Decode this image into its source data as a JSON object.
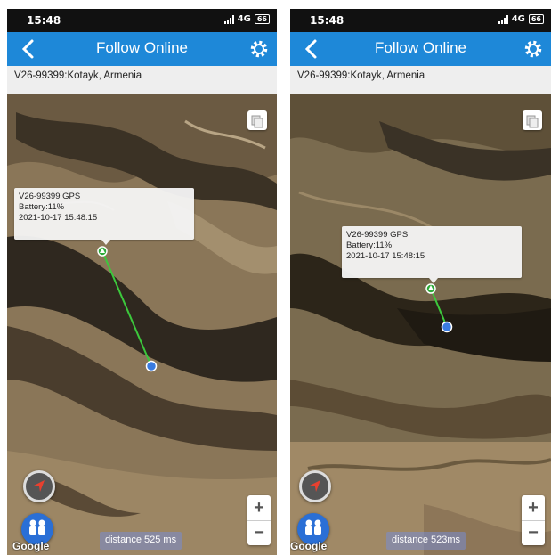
{
  "screens": [
    {
      "status": {
        "time": "15:48",
        "network": "4G",
        "battery": "66"
      },
      "header": {
        "title": "Follow Online"
      },
      "location_label": "V26-99399:Kotayk, Armenia",
      "marker_info": {
        "device": "V26-99399 GPS",
        "battery": "Battery:11%",
        "timestamp": "2021-10-17 15:48:15"
      },
      "distance_label": "distance 525 ms",
      "attribution": "Google",
      "zoom": {
        "in": "+",
        "out": "−"
      }
    },
    {
      "status": {
        "time": "15:48",
        "network": "4G",
        "battery": "66"
      },
      "header": {
        "title": "Follow Online"
      },
      "location_label": "V26-99399:Kotayk, Armenia",
      "marker_info": {
        "device": "V26-99399 GPS",
        "battery": "Battery:11%",
        "timestamp": "2021-10-17 15:48:15"
      },
      "distance_label": "distance 523ms",
      "attribution": "Google",
      "zoom": {
        "in": "+",
        "out": "−"
      }
    }
  ],
  "colors": {
    "appbar": "#1E88D8",
    "route_line": "#3CC83C",
    "user_dot": "#3A7BE0",
    "marker": "#2EAA3A"
  },
  "icons": [
    "back-arrow-icon",
    "gear-icon",
    "signal-icon",
    "battery-icon",
    "layers-icon",
    "navigation-arrow-icon",
    "people-icon"
  ]
}
